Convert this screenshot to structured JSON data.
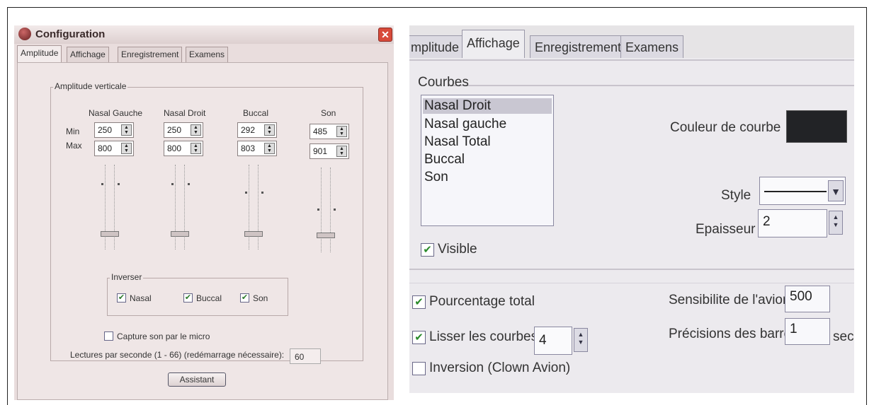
{
  "left": {
    "window_title": "Configuration",
    "close_symbol": "✕",
    "tabs": [
      "Amplitude",
      "Affichage",
      "Enregistrement",
      "Examens"
    ],
    "group_title": "Amplitude verticale",
    "row_labels": {
      "min": "Min",
      "max": "Max"
    },
    "columns": [
      {
        "name": "Nasal Gauche",
        "min": "250",
        "max": "800"
      },
      {
        "name": "Nasal Droit",
        "min": "250",
        "max": "800"
      },
      {
        "name": "Buccal",
        "min": "292",
        "max": "803"
      },
      {
        "name": "Son",
        "min": "485",
        "max": "901"
      }
    ],
    "inverser": {
      "title": "Inverser",
      "items": [
        {
          "label": "Nasal",
          "checked": true
        },
        {
          "label": "Buccal",
          "checked": true
        },
        {
          "label": "Son",
          "checked": true
        }
      ]
    },
    "capture_label": "Capture son par le micro",
    "capture_checked": false,
    "lectures_label": "Lectures par seconde (1 - 66) (redémarrage nécessaire):",
    "lectures_value": "60",
    "assistant_button": "Assistant"
  },
  "right": {
    "tabs": [
      "mplitude",
      "Affichage",
      "Enregistrement",
      "Examens"
    ],
    "courbes_title": "Courbes",
    "curves": [
      "Nasal Droit",
      "Nasal gauche",
      "Nasal Total",
      "Buccal",
      "Son"
    ],
    "selected_curve": "Nasal Droit",
    "couleur_label": "Couleur de courbe",
    "curve_color": "#222326",
    "style_label": "Style",
    "epaisseur_label": "Epaisseur",
    "epaisseur_value": "2",
    "visible_label": "Visible",
    "visible_checked": true,
    "pourcentage_label": "Pourcentage total",
    "pourcentage_checked": true,
    "lisser_label": "Lisser les courbes",
    "lisser_checked": true,
    "lisser_value": "4",
    "inversion_label": "Inversion (Clown Avion)",
    "inversion_checked": false,
    "sensibilite_label": "Sensibilite de l'avion",
    "sensibilite_value": "500",
    "precision_label": "Précisions des barres",
    "precision_value": "1",
    "precision_unit": "sec"
  },
  "symbols": {
    "check": "✔",
    "spin_up": "▲",
    "spin_down": "▼",
    "dropdown": "▼"
  }
}
